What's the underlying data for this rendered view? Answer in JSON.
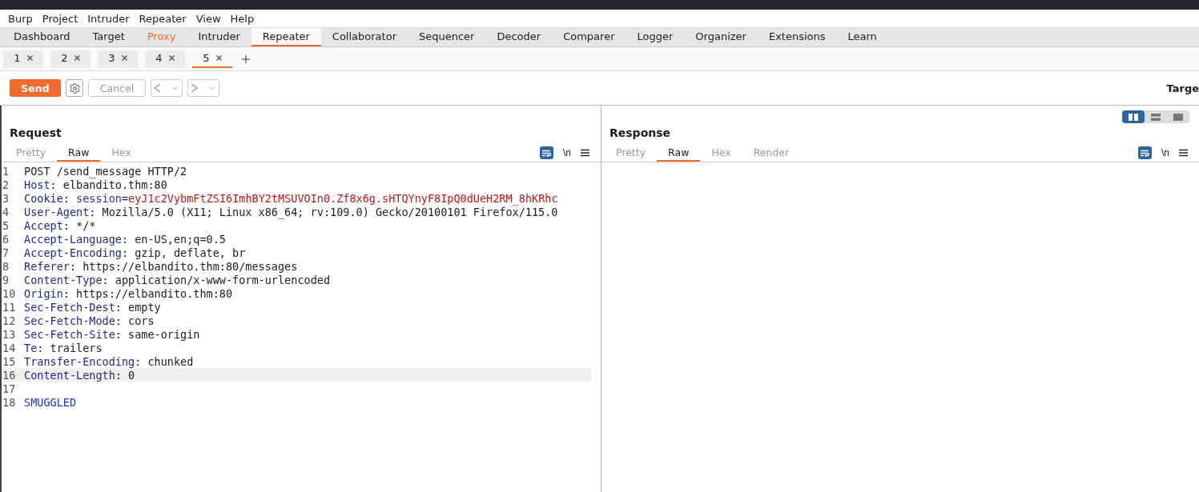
{
  "menu": [
    "Burp",
    "Project",
    "Intruder",
    "Repeater",
    "View",
    "Help"
  ],
  "main_tabs": [
    {
      "label": "Dashboard",
      "selected": false,
      "highlighted": false
    },
    {
      "label": "Target",
      "selected": false,
      "highlighted": false
    },
    {
      "label": "Proxy",
      "selected": false,
      "highlighted": true
    },
    {
      "label": "Intruder",
      "selected": false,
      "highlighted": false
    },
    {
      "label": "Repeater",
      "selected": true,
      "highlighted": false
    },
    {
      "label": "Collaborator",
      "selected": false,
      "highlighted": false
    },
    {
      "label": "Sequencer",
      "selected": false,
      "highlighted": false
    },
    {
      "label": "Decoder",
      "selected": false,
      "highlighted": false
    },
    {
      "label": "Comparer",
      "selected": false,
      "highlighted": false
    },
    {
      "label": "Logger",
      "selected": false,
      "highlighted": false
    },
    {
      "label": "Organizer",
      "selected": false,
      "highlighted": false
    },
    {
      "label": "Extensions",
      "selected": false,
      "highlighted": false
    },
    {
      "label": "Learn",
      "selected": false,
      "highlighted": false
    }
  ],
  "repeater_tabs": [
    {
      "label": "1",
      "selected": false
    },
    {
      "label": "2",
      "selected": false
    },
    {
      "label": "3",
      "selected": false
    },
    {
      "label": "4",
      "selected": false
    },
    {
      "label": "5",
      "selected": true
    }
  ],
  "toolbar": {
    "send": "Send",
    "cancel": "Cancel",
    "target_label": "Targe"
  },
  "request": {
    "title": "Request",
    "tabs": [
      {
        "label": "Pretty",
        "selected": false
      },
      {
        "label": "Raw",
        "selected": true
      },
      {
        "label": "Hex",
        "selected": false
      }
    ],
    "newline_label": "\\n",
    "lines": [
      {
        "number": "1",
        "highlighted": false,
        "segments": [
          {
            "kind": "plain",
            "text": "POST /send_message HTTP/2"
          }
        ]
      },
      {
        "number": "2",
        "highlighted": false,
        "segments": [
          {
            "kind": "header",
            "text": "Host"
          },
          {
            "kind": "plain",
            "text": ": elbandito.thm:80"
          }
        ]
      },
      {
        "number": "3",
        "highlighted": false,
        "segments": [
          {
            "kind": "header",
            "text": "Cookie"
          },
          {
            "kind": "plain",
            "text": ": "
          },
          {
            "kind": "param",
            "text": "session"
          },
          {
            "kind": "plain",
            "text": "="
          },
          {
            "kind": "value",
            "text": "eyJ1c2VybmFtZSI6ImhBY2tMSUVOIn0.Zf8x6g.sHTQYnyF8IpQ0dUeH2RM_8hKRhc"
          }
        ]
      },
      {
        "number": "4",
        "highlighted": false,
        "segments": [
          {
            "kind": "header",
            "text": "User-Agent"
          },
          {
            "kind": "plain",
            "text": ": Mozilla/5.0 (X11; Linux x86_64; rv:109.0) Gecko/20100101 Firefox/115.0"
          }
        ]
      },
      {
        "number": "5",
        "highlighted": false,
        "segments": [
          {
            "kind": "header",
            "text": "Accept"
          },
          {
            "kind": "plain",
            "text": ": */*"
          }
        ]
      },
      {
        "number": "6",
        "highlighted": false,
        "segments": [
          {
            "kind": "header",
            "text": "Accept-Language"
          },
          {
            "kind": "plain",
            "text": ": en-US,en;q=0.5"
          }
        ]
      },
      {
        "number": "7",
        "highlighted": false,
        "segments": [
          {
            "kind": "header",
            "text": "Accept-Encoding"
          },
          {
            "kind": "plain",
            "text": ": gzip, deflate, br"
          }
        ]
      },
      {
        "number": "8",
        "highlighted": false,
        "segments": [
          {
            "kind": "header",
            "text": "Referer"
          },
          {
            "kind": "plain",
            "text": ": https://elbandito.thm:80/messages"
          }
        ]
      },
      {
        "number": "9",
        "highlighted": false,
        "segments": [
          {
            "kind": "header",
            "text": "Content-Type"
          },
          {
            "kind": "plain",
            "text": ": application/x-www-form-urlencoded"
          }
        ]
      },
      {
        "number": "10",
        "highlighted": false,
        "segments": [
          {
            "kind": "header",
            "text": "Origin"
          },
          {
            "kind": "plain",
            "text": ": https://elbandito.thm:80"
          }
        ]
      },
      {
        "number": "11",
        "highlighted": false,
        "segments": [
          {
            "kind": "header",
            "text": "Sec-Fetch-Dest"
          },
          {
            "kind": "plain",
            "text": ": empty"
          }
        ]
      },
      {
        "number": "12",
        "highlighted": false,
        "segments": [
          {
            "kind": "header",
            "text": "Sec-Fetch-Mode"
          },
          {
            "kind": "plain",
            "text": ": cors"
          }
        ]
      },
      {
        "number": "13",
        "highlighted": false,
        "segments": [
          {
            "kind": "header",
            "text": "Sec-Fetch-Site"
          },
          {
            "kind": "plain",
            "text": ": same-origin"
          }
        ]
      },
      {
        "number": "14",
        "highlighted": false,
        "segments": [
          {
            "kind": "header",
            "text": "Te"
          },
          {
            "kind": "plain",
            "text": ": trailers"
          }
        ]
      },
      {
        "number": "15",
        "highlighted": false,
        "segments": [
          {
            "kind": "header",
            "text": "Transfer-Encoding"
          },
          {
            "kind": "plain",
            "text": ": chunked"
          }
        ]
      },
      {
        "number": "16",
        "highlighted": true,
        "segments": [
          {
            "kind": "header",
            "text": "Content-Length"
          },
          {
            "kind": "plain",
            "text": ": 0"
          }
        ]
      },
      {
        "number": "17",
        "highlighted": false
      },
      {
        "number": "18",
        "highlighted": false,
        "segments": [
          {
            "kind": "param",
            "text": "SMUGGLED"
          }
        ]
      }
    ]
  },
  "response": {
    "title": "Response",
    "tabs": [
      {
        "label": "Pretty",
        "selected": false
      },
      {
        "label": "Raw",
        "selected": true
      },
      {
        "label": "Hex",
        "selected": false
      },
      {
        "label": "Render",
        "selected": false
      }
    ],
    "newline_label": "\\n"
  },
  "layout_modes": [
    {
      "kind": "side",
      "selected": true
    },
    {
      "kind": "stacked",
      "selected": false
    },
    {
      "kind": "single",
      "selected": false
    }
  ]
}
